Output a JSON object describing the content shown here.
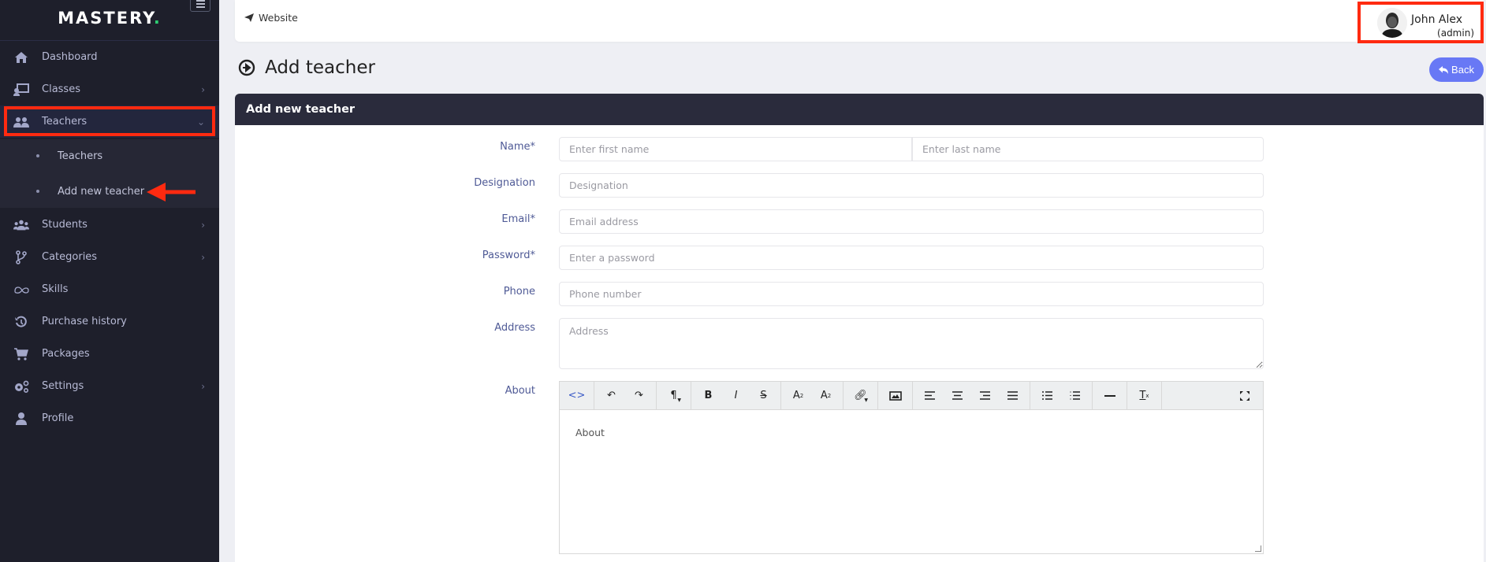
{
  "sidebar": {
    "logo": "MASTERY",
    "logo_dot": ".",
    "toggle_icon": "hamburger-icon",
    "items": [
      {
        "label": "Dashboard",
        "icon": "home-icon",
        "has_children": false
      },
      {
        "label": "Classes",
        "icon": "chalkboard-teacher-icon",
        "has_children": true
      },
      {
        "label": "Teachers",
        "icon": "users-icon",
        "has_children": true,
        "expanded": true,
        "active": true
      },
      {
        "label": "Students",
        "icon": "user-group-icon",
        "has_children": true
      },
      {
        "label": "Categories",
        "icon": "code-branch-icon",
        "has_children": true
      },
      {
        "label": "Skills",
        "icon": "infinity-icon",
        "has_children": false
      },
      {
        "label": "Purchase history",
        "icon": "history-icon",
        "has_children": false
      },
      {
        "label": "Packages",
        "icon": "cart-icon",
        "has_children": false
      },
      {
        "label": "Settings",
        "icon": "cogs-icon",
        "has_children": true
      },
      {
        "label": "Profile",
        "icon": "user-icon",
        "has_children": false
      }
    ],
    "submenu": [
      {
        "label": "Teachers"
      },
      {
        "label": "Add new teacher",
        "current": true
      }
    ]
  },
  "header": {
    "website_label": "Website",
    "website_icon": "paper-plane-icon",
    "user": {
      "name": "John Alex",
      "role": "(admin)"
    }
  },
  "page": {
    "title": "Add teacher",
    "title_icon": "arrow-circle-right-icon",
    "back_label": "Back",
    "back_icon": "reply-icon"
  },
  "form": {
    "card_title": "Add new teacher",
    "fields": {
      "name": {
        "label": "Name*",
        "first_placeholder": "Enter first name",
        "last_placeholder": "Enter last name",
        "first_value": "",
        "last_value": ""
      },
      "designation": {
        "label": "Designation",
        "placeholder": "Designation",
        "value": ""
      },
      "email": {
        "label": "Email*",
        "placeholder": "Email address",
        "value": ""
      },
      "password": {
        "label": "Password*",
        "placeholder": "Enter a password",
        "value": ""
      },
      "phone": {
        "label": "Phone",
        "placeholder": "Phone number",
        "value": ""
      },
      "address": {
        "label": "Address",
        "placeholder": "Address",
        "value": ""
      },
      "about": {
        "label": "About",
        "placeholder": "About",
        "value": ""
      }
    },
    "editor_toolbar": [
      [
        "code-view-icon"
      ],
      [
        "undo-icon",
        "redo-icon"
      ],
      [
        "paragraph-icon"
      ],
      [
        "bold-icon",
        "italic-icon",
        "strikethrough-icon"
      ],
      [
        "superscript-icon",
        "subscript-icon"
      ],
      [
        "link-icon"
      ],
      [
        "image-icon"
      ],
      [
        "align-left-icon",
        "align-center-icon",
        "align-right-icon",
        "align-justify-icon"
      ],
      [
        "unordered-list-icon",
        "ordered-list-icon"
      ],
      [
        "horizontal-rule-icon"
      ],
      [
        "clear-format-icon"
      ],
      [
        "fullscreen-icon"
      ]
    ]
  },
  "colors": {
    "sidebar_bg": "#1e1f2b",
    "accent_green": "#2ecc71",
    "card_header_bg": "#2a2b3c",
    "back_button": "#6878f5",
    "label_color": "#4f5a96",
    "annotation_red": "#ff2a10"
  }
}
